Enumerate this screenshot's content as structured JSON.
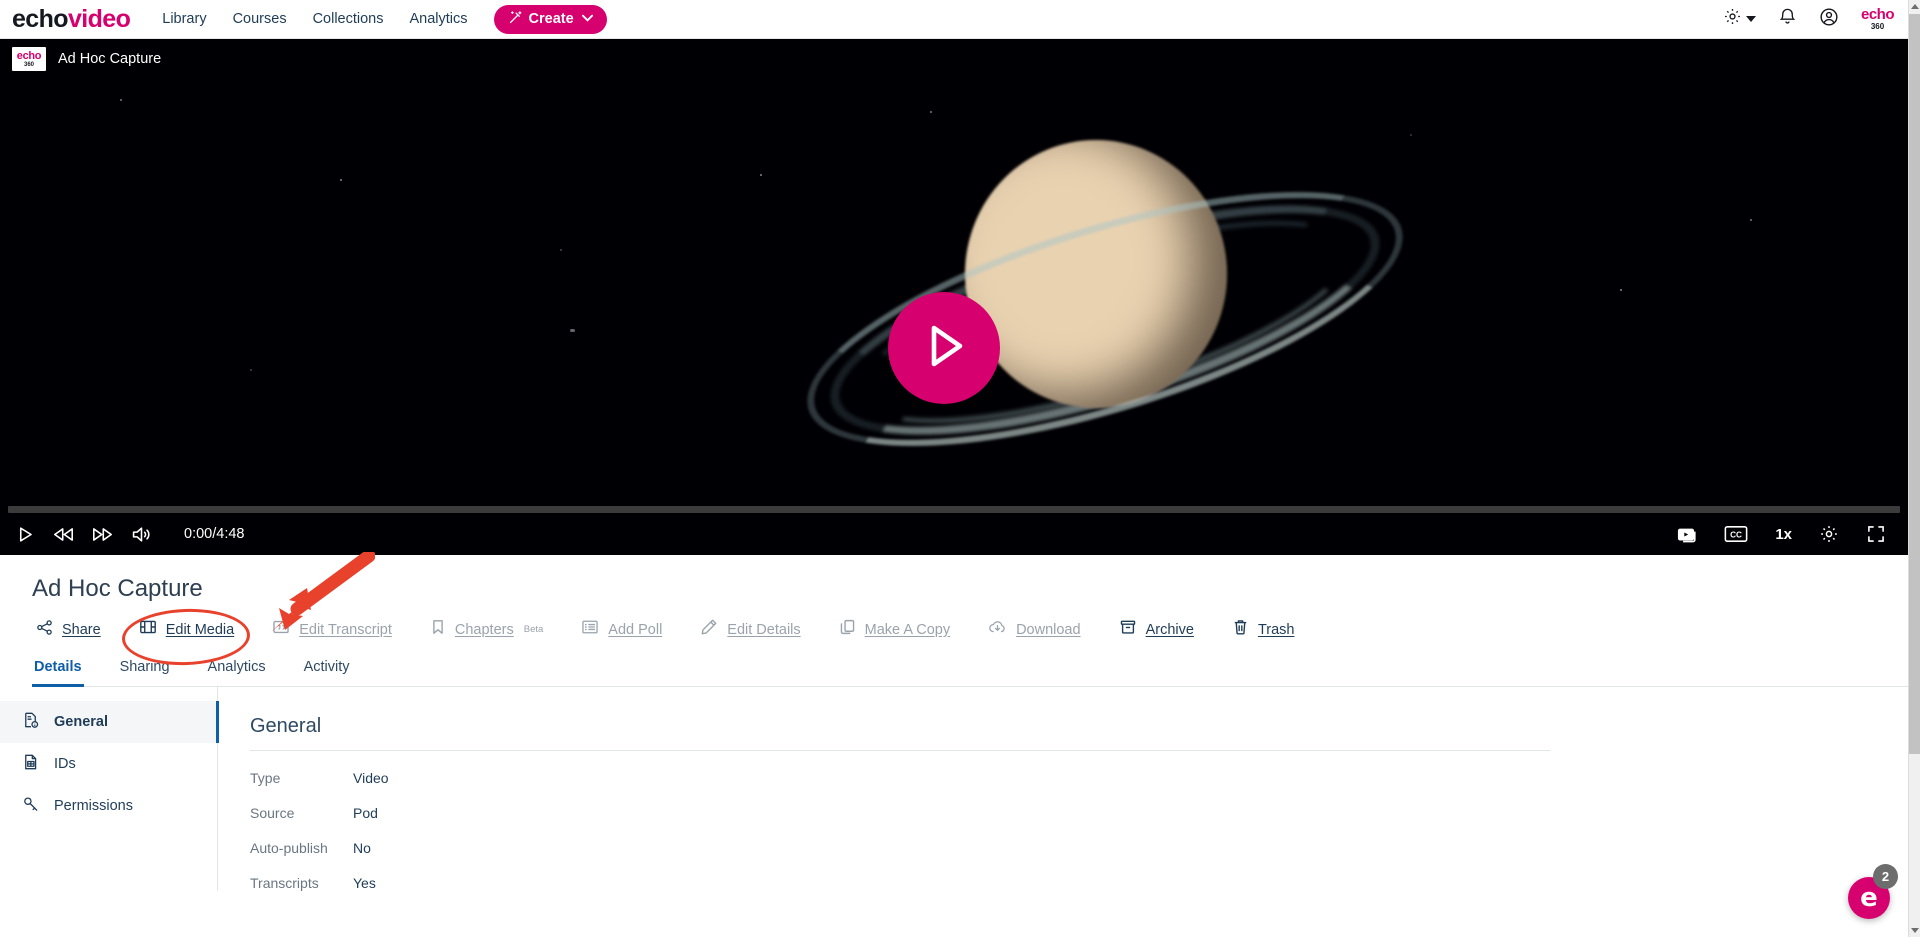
{
  "topnav": {
    "brand_echo": "echo",
    "brand_video": "video",
    "links": [
      {
        "label": "Library"
      },
      {
        "label": "Courses"
      },
      {
        "label": "Collections"
      },
      {
        "label": "Analytics"
      }
    ],
    "create_label": "Create",
    "create_chevron": "⌄",
    "icons": {
      "settings": "gear-icon",
      "notifications": "bell-icon",
      "account": "account-circle-icon"
    },
    "corner_logo_top": "echo",
    "corner_logo_bottom": "360",
    "accent_color": "#d6006e",
    "link_color": "#1f3c57"
  },
  "player": {
    "logo_top": "echo",
    "logo_bottom": "360",
    "title": "Ad Hoc Capture",
    "play_overlay_icon": "play-icon",
    "play_overlay_color": "#d6006e",
    "timecode": "0:00/4:48",
    "current_time": "0:00",
    "duration": "4:48",
    "progress_percent": 0,
    "speed_label": "1x",
    "controls_left": [
      {
        "name": "play-button",
        "icon": "play-icon"
      },
      {
        "name": "rewind-button",
        "icon": "rewind-icon"
      },
      {
        "name": "fast-forward-button",
        "icon": "fast-forward-icon"
      },
      {
        "name": "volume-button",
        "icon": "volume-icon"
      }
    ],
    "controls_right": [
      {
        "name": "multi-video-button",
        "icon": "multi-video-icon"
      },
      {
        "name": "closed-captions-button",
        "icon": "cc-icon",
        "label": "CC"
      },
      {
        "name": "playback-speed-button",
        "icon": "speed-text",
        "label": "1x"
      },
      {
        "name": "player-settings-button",
        "icon": "gear-icon"
      },
      {
        "name": "fullscreen-button",
        "icon": "fullscreen-icon"
      }
    ]
  },
  "details": {
    "title": "Ad Hoc Capture",
    "actions": [
      {
        "label": "Share",
        "icon": "share-nodes-icon",
        "state": "dark"
      },
      {
        "label": "Edit Media",
        "icon": "film-strip-icon",
        "state": "dark"
      },
      {
        "label": "Edit Transcript",
        "icon": "quote-icon",
        "state": "muted"
      },
      {
        "label": "Chapters",
        "sup": "Beta",
        "icon": "bookmark-icon",
        "state": "muted"
      },
      {
        "label": "Add Poll",
        "icon": "list-icon",
        "state": "muted"
      },
      {
        "label": "Edit Details",
        "icon": "pencil-icon",
        "state": "muted"
      },
      {
        "label": "Make A Copy",
        "icon": "copy-icon",
        "state": "muted"
      },
      {
        "label": "Download",
        "icon": "cloud-download-icon",
        "state": "muted"
      },
      {
        "label": "Archive",
        "icon": "archive-box-icon",
        "state": "dark"
      },
      {
        "label": "Trash",
        "icon": "trash-icon",
        "state": "dark"
      }
    ],
    "tabs": [
      {
        "label": "Details",
        "active": true
      },
      {
        "label": "Sharing",
        "active": false
      },
      {
        "label": "Analytics",
        "active": false
      },
      {
        "label": "Activity",
        "active": false
      }
    ],
    "sidebar": [
      {
        "label": "General",
        "icon": "document-info-icon",
        "active": true
      },
      {
        "label": "IDs",
        "icon": "document-table-icon",
        "active": false
      },
      {
        "label": "Permissions",
        "icon": "key-icon",
        "active": false
      }
    ],
    "section_heading": "General",
    "fields": [
      {
        "key": "Type",
        "value": "Video"
      },
      {
        "key": "Source",
        "value": "Pod"
      },
      {
        "key": "Auto-publish",
        "value": "No"
      },
      {
        "key": "Transcripts",
        "value": "Yes"
      }
    ]
  },
  "annotations": {
    "highlight_color": "#e8412c",
    "ellipse_target": "Edit Media",
    "arrow_target": "Edit Media"
  },
  "help_widget": {
    "glyph": "e",
    "badge_count": "2",
    "color": "#d6006e"
  }
}
